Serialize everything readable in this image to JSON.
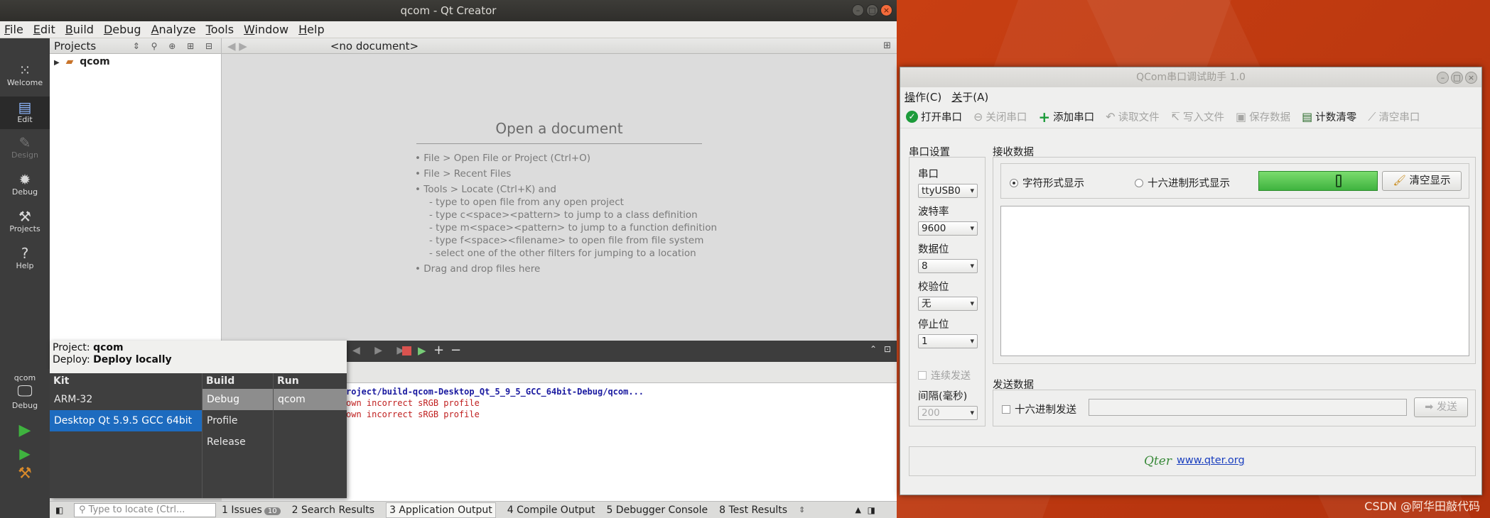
{
  "qtcreator": {
    "title": "qcom - Qt Creator",
    "menu": [
      "File",
      "Edit",
      "Build",
      "Debug",
      "Analyze",
      "Tools",
      "Window",
      "Help"
    ],
    "modes": [
      {
        "label": "Welcome",
        "icon": "grid-icon"
      },
      {
        "label": "Edit",
        "icon": "edit-icon"
      },
      {
        "label": "Design",
        "icon": "pencil-icon"
      },
      {
        "label": "Debug",
        "icon": "bug-icon"
      },
      {
        "label": "Projects",
        "icon": "wrench-icon"
      },
      {
        "label": "Help",
        "icon": "help-icon"
      }
    ],
    "projects_header": "Projects",
    "project_tree_item": "qcom",
    "document_selector": "<no document>",
    "open_doc_title": "Open a document",
    "hints": {
      "h1": "• File > Open File or Project (Ctrl+O)",
      "h2": "• File > Recent Files",
      "h3": "• Tools > Locate (Ctrl+K) and",
      "s1": "- type to open file from any open project",
      "s2": "- type c<space><pattern> to jump to a class definition",
      "s3": "- type m<space><pattern> to jump to a function definition",
      "s4": "- type f<space><filename> to open file from file system",
      "s5": "- select one of the other filters for jumping to a location",
      "h4": "• Drag and drop files here"
    },
    "output_lines": {
      "l1": "roject/build-qcom-Desktop_Qt_5_9_5_GCC_64bit-Debug/qcom...",
      "l2": "own incorrect sRGB profile",
      "l3": "own incorrect sRGB profile"
    },
    "kit_popup": {
      "project_label": "Project:",
      "project_name": "qcom",
      "deploy_label": "Deploy:",
      "deploy_value": "Deploy locally",
      "kit_header": "Kit",
      "build_header": "Build",
      "run_header": "Run",
      "kits": [
        "ARM-32",
        "Desktop Qt 5.9.5 GCC 64bit"
      ],
      "builds": [
        "Debug",
        "Profile",
        "Release"
      ],
      "runs": [
        "qcom"
      ]
    },
    "runpane": {
      "project": "qcom",
      "mode": "Debug"
    },
    "statusbar": {
      "locate_placeholder": "Type to locate (Ctrl...",
      "tabs": [
        "1  Issues",
        "2  Search Results",
        "3  Application Output",
        "4  Compile Output",
        "5  Debugger Console",
        "8  Test Results"
      ],
      "issues_count": "10"
    }
  },
  "qcom": {
    "title": "QCom串口调试助手 1.0",
    "menu": [
      "操作(C)",
      "关于(A)"
    ],
    "toolbar": [
      {
        "label": "打开串口",
        "icon": "check-icon",
        "enabled": true
      },
      {
        "label": "关闭串口",
        "icon": "minus-circle-icon",
        "enabled": false
      },
      {
        "label": "添加串口",
        "icon": "plus-icon",
        "enabled": true
      },
      {
        "label": "读取文件",
        "icon": "read-file-icon",
        "enabled": false
      },
      {
        "label": "写入文件",
        "icon": "write-file-icon",
        "enabled": false
      },
      {
        "label": "保存数据",
        "icon": "save-icon",
        "enabled": false
      },
      {
        "label": "计数清零",
        "icon": "counter-icon",
        "enabled": true
      },
      {
        "label": "清空串口",
        "icon": "broom-icon",
        "enabled": false
      }
    ],
    "serial_settings": {
      "title": "串口设置",
      "port_label": "串口",
      "port": "ttyUSB0",
      "baud_label": "波特率",
      "baud": "9600",
      "data_label": "数据位",
      "data": "8",
      "parity_label": "校验位",
      "parity": "无",
      "stop_label": "停止位",
      "stop": "1",
      "continuous_label": "连续发送",
      "interval_label": "间隔(毫秒)",
      "interval": "200"
    },
    "receive": {
      "title": "接收数据",
      "char_mode": "字符形式显示",
      "hex_mode": "十六进制形式显示",
      "clear_btn": "清空显示"
    },
    "send": {
      "title": "发送数据",
      "hex_send": "十六进制发送",
      "send_btn": "发送"
    },
    "footer": {
      "logo": "Qter",
      "link": "www.qter.org"
    }
  },
  "watermark": "CSDN @阿华田敲代码"
}
